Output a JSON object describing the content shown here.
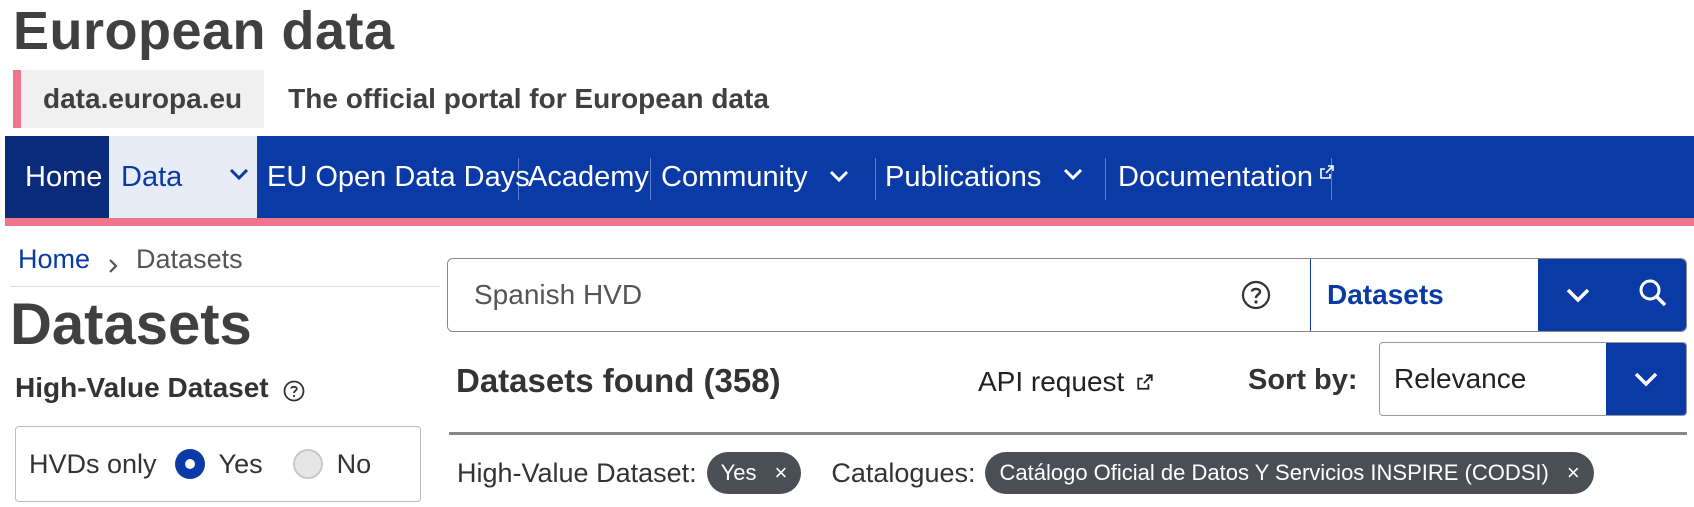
{
  "site": {
    "title": "European data",
    "identity": "data.europa.eu",
    "tagline": "The official portal for European data"
  },
  "nav": {
    "items": [
      "Home",
      "Data",
      "EU Open Data Days",
      "Academy",
      "Community",
      "Publications",
      "Documentation"
    ],
    "active": "Data"
  },
  "breadcrumb": {
    "home": "Home",
    "current": "Datasets"
  },
  "page": {
    "title": "Datasets"
  },
  "hvd_filter": {
    "title": "High-Value Dataset",
    "row_label": "HVDs only",
    "yes_label": "Yes",
    "no_label": "No",
    "selected": "Yes"
  },
  "search": {
    "query": "Spanish HVD",
    "type": "Datasets"
  },
  "results": {
    "found_label": "Datasets found (358)",
    "api_label": "API request",
    "sort_label": "Sort by:",
    "sort_value": "Relevance"
  },
  "active_filters": {
    "hvd_label": "High-Value Dataset:",
    "hvd_chip": "Yes",
    "catalogues_label": "Catalogues:",
    "catalogue_chip": "Catálogo Oficial de Datos Y Servicios INSPIRE (CODSI)",
    "remove_symbol": "×"
  },
  "colors": {
    "primary": "#0a3aa6",
    "accent": "#f0758b",
    "chip": "#4a4f55"
  }
}
